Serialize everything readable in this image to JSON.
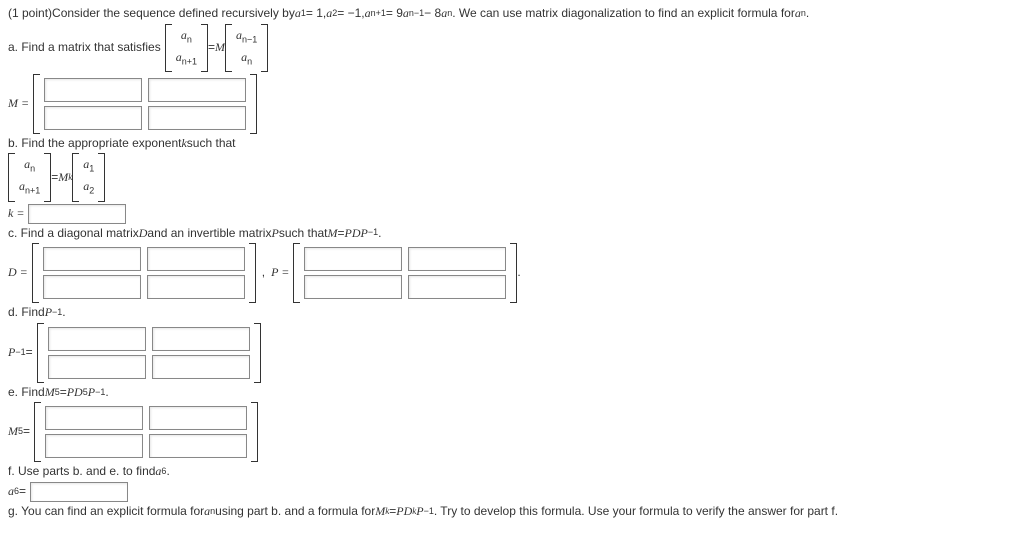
{
  "intro": {
    "points": "(1 point) ",
    "t1": "Consider the sequence defined recursively by ",
    "a1": "a",
    "a1s": "1",
    "eq1": " = 1, ",
    "a2": "a",
    "a2s": "2",
    "eq2": " = −1, ",
    "anp1": "a",
    "anp1s": "n+1",
    "eq3": " = 9",
    "anm1": "a",
    "anm1s": "n−1",
    "minus": " − 8",
    "an": "a",
    "ans": "n",
    "tail": ". We can use matrix diagonalization to find an explicit formula for ",
    "af": "a",
    "afs": "n",
    "dot": "."
  },
  "a": {
    "label": "a. Find a matrix that satisfies ",
    "v1t": "a",
    "v1ts": "n",
    "v1b": "a",
    "v1bs": "n+1",
    "eq": " = ",
    "M": "M ",
    "v2t": "a",
    "v2ts": "n−1",
    "v2b": "a",
    "v2bs": "n",
    "Mlabel": "M ="
  },
  "b": {
    "label": "b. Find the appropriate exponent ",
    "kvar": "k",
    "label2": " such that",
    "v1t": "a",
    "v1ts": "n",
    "v1b": "a",
    "v1bs": "n+1",
    "eq": " = ",
    "M": "M",
    "kexp": "k",
    "v2t": "a",
    "v2ts": "1",
    "v2b": "a",
    "v2bs": "2",
    "keq": "k ="
  },
  "c": {
    "label": "c. Find a diagonal matrix ",
    "D": "D",
    "and": " and an invertible matrix ",
    "P": "P",
    "such": " such that ",
    "M": "M",
    " eq": " = ",
    "PDPm1": "PDP",
    "neg1": "−1",
    "dot": ".",
    "Dlabel": "D =",
    "comma": ",",
    "Plabel": "P ="
  },
  "d": {
    "label": "d. Find ",
    "P": "P",
    "neg1": "−1",
    "dot": ".",
    "Plabel": "P",
    "Pexp": "−1",
    "eq": " ="
  },
  "e": {
    "label": "e. Find ",
    "M": "M",
    "five": "5",
    "eq1": " = ",
    "PD": "PD",
    "5": "5",
    "P": "P",
    "neg1": "−1",
    "dot": ".",
    "Mlabel": "M",
    "Mexp": "5",
    "eq": " ="
  },
  "f": {
    "label": "f. Use parts b. and e. to find ",
    "a": "a",
    "six": "6",
    "dot": ".",
    "aeq": "a",
    "aeqs": "6",
    "eq": " ="
  },
  "g": {
    "t1": "g. You can find an explicit formula for ",
    "an": "a",
    "ans": "n",
    "t2": " using part b. and a formula for ",
    "M": "M",
    "k": "k",
    "eq": " = ",
    "PD": "PD",
    "k2": "k",
    "P": "P",
    "neg1": "−1",
    "t3": ". Try to develop this formula. Use your formula to verify the answer for part f."
  }
}
